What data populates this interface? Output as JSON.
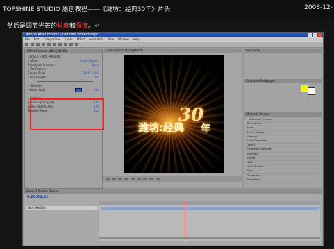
{
  "header": {
    "title": "TOPSHINE STUDIO 原创教程——《潍坊：经典30年》片头",
    "date": "2008-12-"
  },
  "subtitle": {
    "text_before": "然后是调节光芒的",
    "highlight1": "长度",
    "text_middle": "和",
    "highlight2": "强度",
    "text_after": "。",
    "mark": "↵"
  },
  "app": {
    "window_title": "Adobe After Effects - Untitled Project.aep *",
    "menu": [
      "File",
      "Edit",
      "Composition",
      "Layer",
      "Effect",
      "Animation",
      "View",
      "Window",
      "Help"
    ],
    "effect_controls": {
      "tab_label": "Effect Controls: 潍坊:经典30年 ▾",
      "rows": [
        {
          "label": "Comp 1 • 潍坊:经典30年"
        },
        {
          "label": "▸ Shine",
          "value": "Reset  About..."
        },
        {
          "label": "  Animation Presets",
          "value": "None"
        },
        {
          "label": "▾ Pre-Process"
        },
        {
          "label": "  Source Point",
          "value": "320.0, 240.0"
        },
        {
          "label": "▸ Ray Length",
          "value": "6.0"
        },
        {
          "label": "▸ Shimmer"
        },
        {
          "label": "▸ Boost Light",
          "value": "0.0"
        },
        {
          "label": "▸ Colorize"
        },
        {
          "label": "  Source Opacity (%)",
          "value": "100"
        },
        {
          "label": "  Shine Opacity (%)",
          "value": "100"
        },
        {
          "label": "  Transfer Mode",
          "value": "Add"
        }
      ]
    },
    "composition": {
      "tab_label": "Composition: 潍坊:经典30年",
      "title_text": "潍坊:经典",
      "numeral": "30",
      "suffix": "年"
    },
    "right_panels": {
      "info_tab": "Info  Audio",
      "character_tab": "Character  Paragraph",
      "effects_tab": "Effects & Presets",
      "effects_list": [
        "* Animation Presets",
        "3D Channel",
        "Audio",
        "Blur & Sharpen",
        "Channel",
        "Color Correction",
        "Distort",
        "Expression Controls",
        "Generate",
        "Keying",
        "Matte",
        "Noise & Grain",
        "Paint",
        "Perspective",
        "Simulation"
      ],
      "highlight_color": "#f3f300"
    },
    "timeline": {
      "tab_label": "Comp 1   Render Queue",
      "timecode": "0:00:03:11",
      "layer_name": "潍坊:经典30年"
    }
  }
}
